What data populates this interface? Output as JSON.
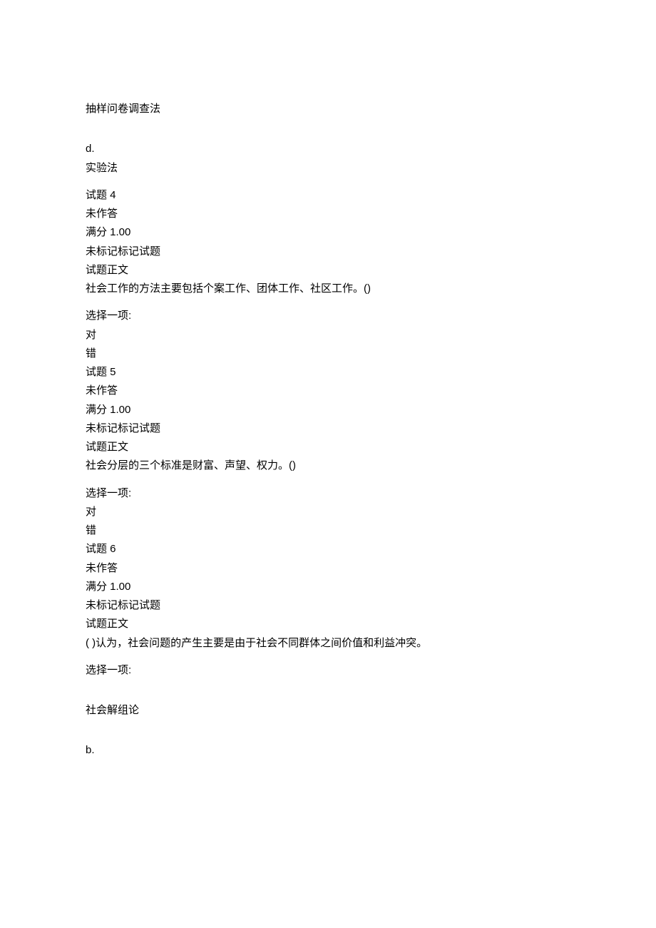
{
  "lines": {
    "l1": "抽样问卷调查法",
    "l2": "d.",
    "l3": "实验法",
    "l4": "试题 4",
    "l5": "未作答",
    "l6": "满分 1.00",
    "l7": "未标记标记试题",
    "l8": "试题正文",
    "l9": "社会工作的方法主要包括个案工作、团体工作、社区工作。()",
    "l10": "选择一项:",
    "l11": "对",
    "l12": "错",
    "l13": "试题 5",
    "l14": "未作答",
    "l15": "满分 1.00",
    "l16": "未标记标记试题",
    "l17": "试题正文",
    "l18": "社会分层的三个标准是财富、声望、权力。()",
    "l19": "选择一项:",
    "l20": "对",
    "l21": "错",
    "l22": "试题 6",
    "l23": "未作答",
    "l24": "满分 1.00",
    "l25": "未标记标记试题",
    "l26": "试题正文",
    "l27": "(       )认为，社会问题的产生主要是由于社会不同群体之间价值和利益冲突。",
    "l28": "选择一项:",
    "l29": "社会解组论",
    "l30": "b."
  }
}
